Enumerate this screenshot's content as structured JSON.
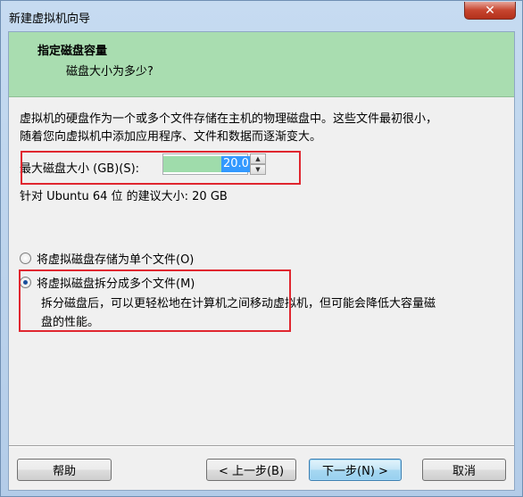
{
  "window": {
    "title": "新建虚拟机向导"
  },
  "header": {
    "title": "指定磁盘容量",
    "subtitle": "磁盘大小为多少?"
  },
  "description": {
    "line1": "虚拟机的硬盘作为一个或多个文件存储在主机的物理磁盘中。这些文件最初很小，",
    "line2": "随着您向虚拟机中添加应用程序、文件和数据而逐渐变大。"
  },
  "disk_size": {
    "label": "最大磁盘大小 (GB)(S):",
    "value": "20.0"
  },
  "recommended": "针对 Ubuntu 64 位 的建议大小: 20 GB",
  "options": {
    "single": {
      "label": "将虚拟磁盘存储为单个文件(O)",
      "checked": false
    },
    "split": {
      "label": "将虚拟磁盘拆分成多个文件(M)",
      "checked": true,
      "desc_line1": "拆分磁盘后，可以更轻松地在计算机之间移动虚拟机，但可能会降低大容量磁",
      "desc_line2": "盘的性能。"
    }
  },
  "buttons": {
    "help": "帮助",
    "back": "< 上一步(B)",
    "next": "下一步(N) >",
    "cancel": "取消"
  },
  "colors": {
    "header_band": "#a9ddb0",
    "highlight_box": "#e0262f",
    "selection": "#3399ff"
  }
}
